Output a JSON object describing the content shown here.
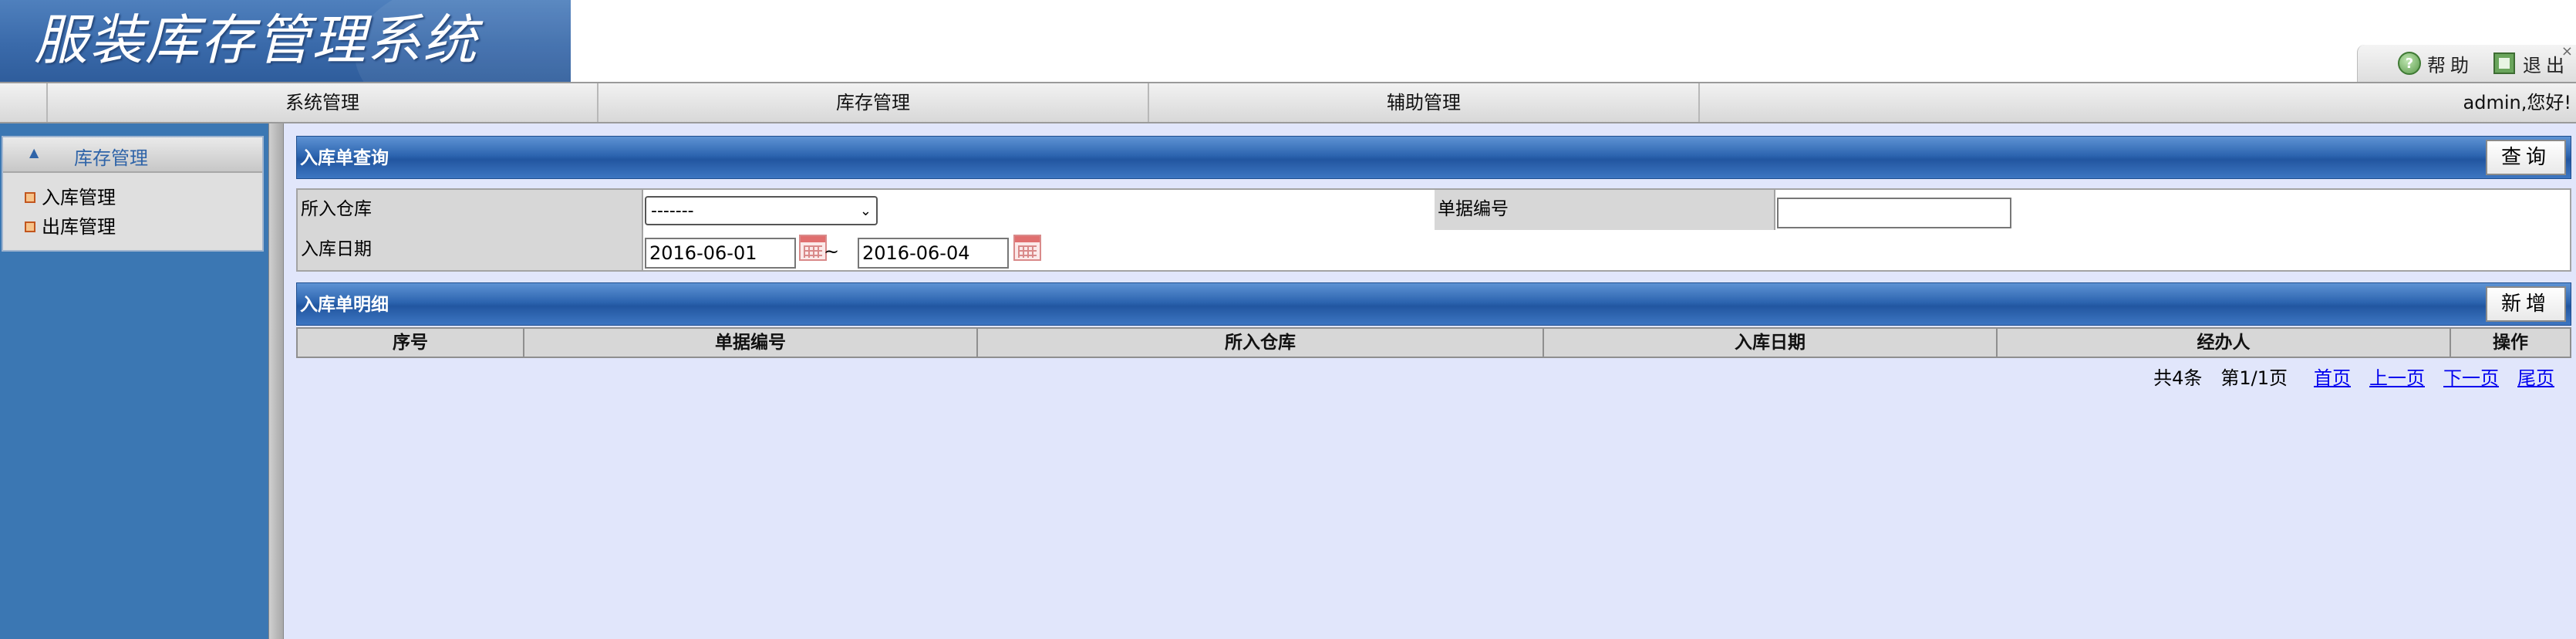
{
  "app": {
    "title": "服装库存管理系统"
  },
  "toolbox": {
    "help_label": "帮助",
    "exit_label": "退出",
    "close_glyph": "×"
  },
  "nav": {
    "items": [
      "系统管理",
      "库存管理",
      "辅助管理"
    ],
    "welcome": "admin,您好!"
  },
  "sidebar": {
    "section_title": "库存管理",
    "section_arrow": "▲",
    "items": [
      "入库管理",
      "出库管理"
    ]
  },
  "query": {
    "title": "入库单查询",
    "search_button": "查询",
    "warehouse_label": "所入仓库",
    "warehouse_selected": "-------",
    "billno_label": "单据编号",
    "billno_value": "",
    "date_label": "入库日期",
    "date_start": "2016-06-01",
    "date_separator": "~",
    "date_end": "2016-06-04"
  },
  "detail": {
    "title": "入库单明细",
    "add_button": "新增",
    "columns": [
      "序号",
      "单据编号",
      "所入仓库",
      "入库日期",
      "经办人",
      "操作"
    ],
    "rows": []
  },
  "pager": {
    "total": "共4条",
    "page_info": "第1/1页",
    "first": "首页",
    "prev": "上一页",
    "next": "下一页",
    "last": "尾页"
  },
  "colors": {
    "header_blue": "#3a6aaa",
    "sidebar_blue": "#3b77b3",
    "content_bg": "#e1e6fb",
    "link_blue": "#0000ee"
  }
}
